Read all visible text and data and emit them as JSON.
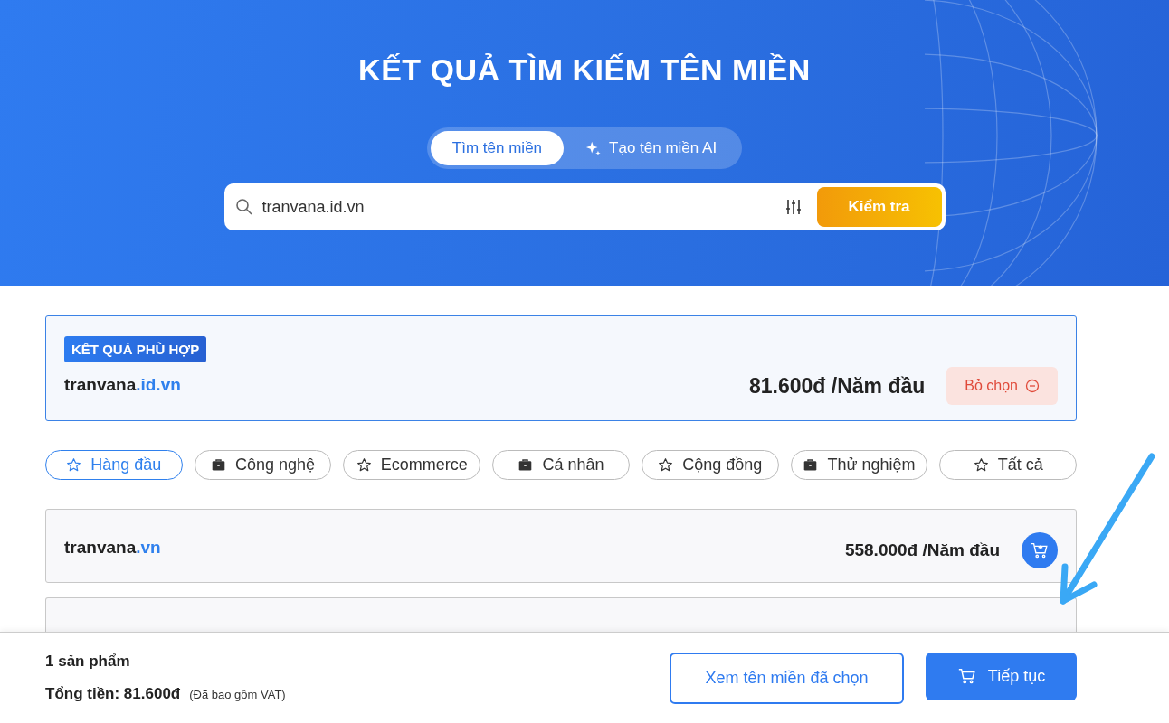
{
  "header": {
    "title": "KẾT QUẢ TÌM KIẾM TÊN MIỀN"
  },
  "tabs": [
    {
      "label": "Tìm tên miền",
      "selected": true,
      "kind": "plain"
    },
    {
      "label": "Tạo tên miền AI",
      "selected": false,
      "kind": "ai"
    }
  ],
  "search": {
    "value": "tranvana.id.vn",
    "button": "Kiểm tra"
  },
  "featured": {
    "badge": "KẾT QUẢ PHÙ HỢP",
    "name": "tranvana",
    "extension": ".id.vn",
    "price": "81.600đ /Năm đầu",
    "button": "Bỏ chọn"
  },
  "categories": [
    {
      "label": "Hàng đầu",
      "selected": true,
      "kind": "star"
    },
    {
      "label": "Công nghệ",
      "selected": false,
      "kind": "briefcase"
    },
    {
      "label": "Ecommerce",
      "selected": false,
      "kind": "star"
    },
    {
      "label": "Cá nhân",
      "selected": false,
      "kind": "briefcase"
    },
    {
      "label": "Cộng đồng",
      "selected": false,
      "kind": "star"
    },
    {
      "label": "Thử nghiệm",
      "selected": false,
      "kind": "briefcase"
    },
    {
      "label": "Tất cả",
      "selected": false,
      "kind": "star"
    }
  ],
  "results": [
    {
      "name": "tranvana",
      "extension": ".vn",
      "price": "558.000đ /Năm đầu"
    }
  ],
  "footer": {
    "count": "1 sản phẩm",
    "total_label": "Tổng tiền: 81.600đ",
    "vat_note": "(Đã bao gồm VAT)",
    "view_button": "Xem tên miền đã chọn",
    "continue_button": "Tiếp tục"
  }
}
